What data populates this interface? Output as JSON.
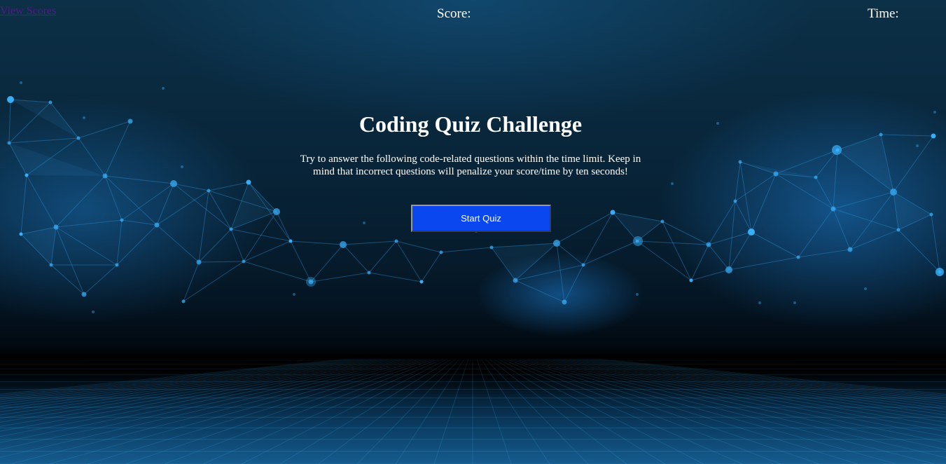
{
  "header": {
    "view_scores_label": "View Scores",
    "score_label": "Score:",
    "time_label": "Time:"
  },
  "intro": {
    "title": "Coding Quiz Challenge",
    "description": "Try to answer the following code-related questions within the time limit. Keep in mind that incorrect questions will penalize your score/time by ten seconds!",
    "start_button_label": "Start Quiz"
  },
  "colors": {
    "start_button": "#0b47ef",
    "text": "#ffffff",
    "link_visited": "#551a8b",
    "background_dark": "#061c2d",
    "network_blue": "#2aa8f0"
  }
}
